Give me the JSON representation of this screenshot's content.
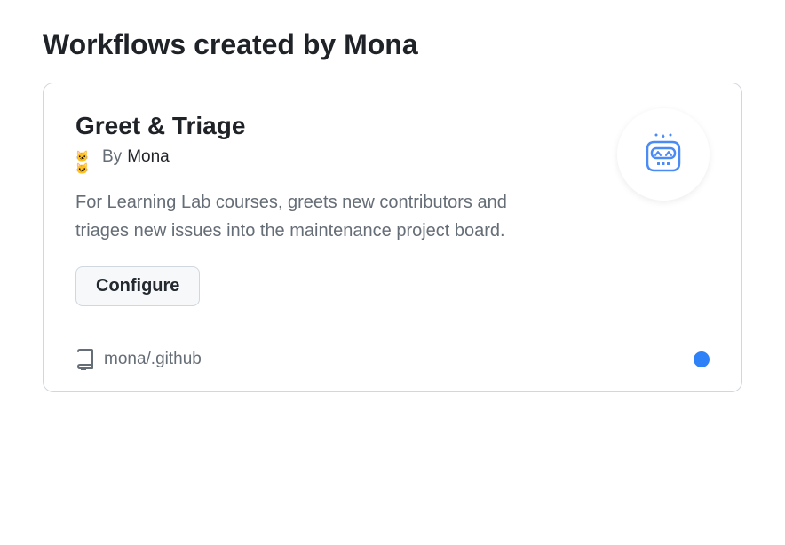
{
  "page": {
    "title": "Workflows created by Mona"
  },
  "workflow": {
    "title": "Greet & Triage",
    "byline_prefix": "By",
    "author": "Mona",
    "description": "For Learning Lab courses, greets new contributors and triages new issues into the maintenance project board.",
    "configure_label": "Configure",
    "repo": "mona/.github"
  },
  "colors": {
    "accent": "#2f81f7"
  }
}
